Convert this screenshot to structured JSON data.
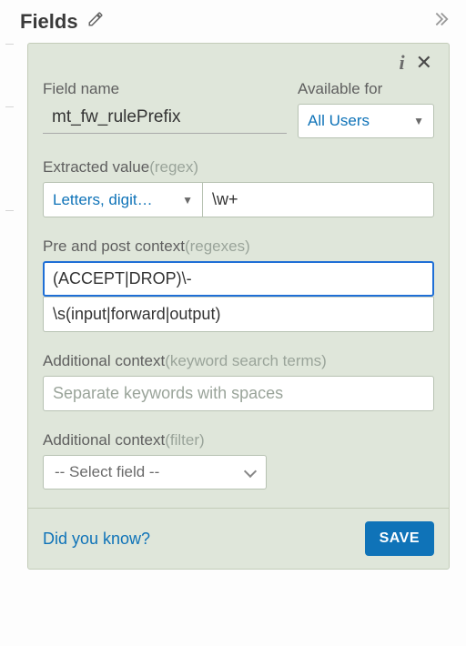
{
  "header": {
    "title": "Fields"
  },
  "panel": {
    "field_name_label": "Field name",
    "field_name_value": "mt_fw_rulePrefix",
    "available_for_label": "Available for",
    "available_for_value": "All Users",
    "extracted_value": {
      "label": "Extracted value",
      "hint": "(regex)",
      "preset": "Letters, digit…",
      "regex": "\\w+"
    },
    "pre_post_context": {
      "label": "Pre and post context",
      "hint": "(regexes)",
      "pre": "(ACCEPT|DROP)\\-",
      "post": "\\s(input|forward|output)"
    },
    "additional_keywords": {
      "label": "Additional context",
      "hint": "(keyword search terms)",
      "placeholder": "Separate keywords with spaces",
      "value": ""
    },
    "additional_filter": {
      "label": "Additional context",
      "hint": "(filter)",
      "placeholder": "-- Select field --"
    }
  },
  "footer": {
    "help_link": "Did you know?",
    "save_label": "SAVE"
  }
}
